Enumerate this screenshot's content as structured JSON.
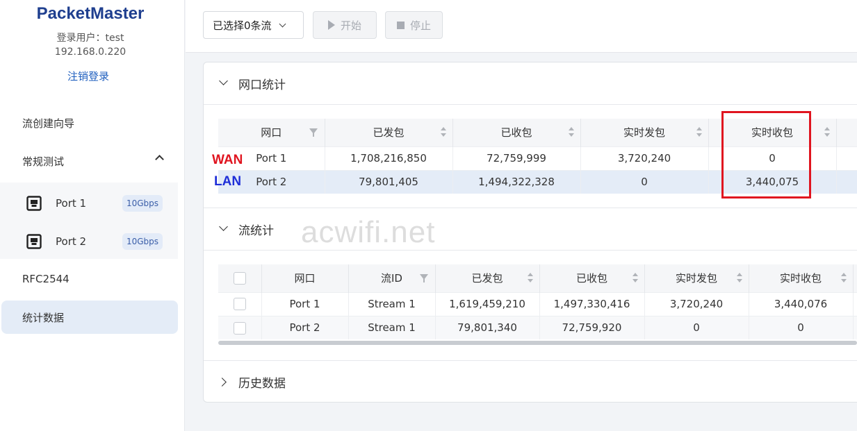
{
  "sidebar": {
    "brand": "PacketMaster",
    "user_line": "登录用户：test",
    "ip": "192.168.0.220",
    "logout": "注销登录",
    "nav": {
      "wizard": "流创建向导",
      "general_test": "常规测试",
      "rfc": "RFC2544",
      "stats": "统计数据"
    },
    "ports": [
      {
        "label": "Port 1",
        "speed": "10Gbps"
      },
      {
        "label": "Port 2",
        "speed": "10Gbps"
      }
    ]
  },
  "toolbar": {
    "select_label": "已选择0条流",
    "start_label": "开始",
    "stop_label": "停止"
  },
  "port_stats": {
    "title": "网口统计",
    "headers": [
      "网口",
      "已发包",
      "已收包",
      "实时发包",
      "实时收包"
    ],
    "rows": [
      {
        "port": "Port 1",
        "sent": "1,708,216,850",
        "recv": "72,759,999",
        "rt_sent": "3,720,240",
        "rt_recv": "0"
      },
      {
        "port": "Port 2",
        "sent": "79,801,405",
        "recv": "1,494,322,328",
        "rt_sent": "0",
        "rt_recv": "3,440,075"
      }
    ]
  },
  "flow_stats": {
    "title": "流统计",
    "headers": [
      "网口",
      "流ID",
      "已发包",
      "已收包",
      "实时发包",
      "实时收包"
    ],
    "rows": [
      {
        "port": "Port 1",
        "flow": "Stream 1",
        "sent": "1,619,459,210",
        "recv": "1,497,330,416",
        "rt_sent": "3,720,240",
        "rt_recv": "3,440,076"
      },
      {
        "port": "Port 2",
        "flow": "Stream 1",
        "sent": "79,801,340",
        "recv": "72,759,920",
        "rt_sent": "0",
        "rt_recv": "0"
      }
    ]
  },
  "history": {
    "title": "历史数据"
  },
  "annotations": {
    "wan": "WAN",
    "lan": "LAN",
    "wan_color": "#e0141f",
    "lan_color": "#1f2fd8",
    "box_color": "#e0141f"
  },
  "watermark": "acwifi.net"
}
